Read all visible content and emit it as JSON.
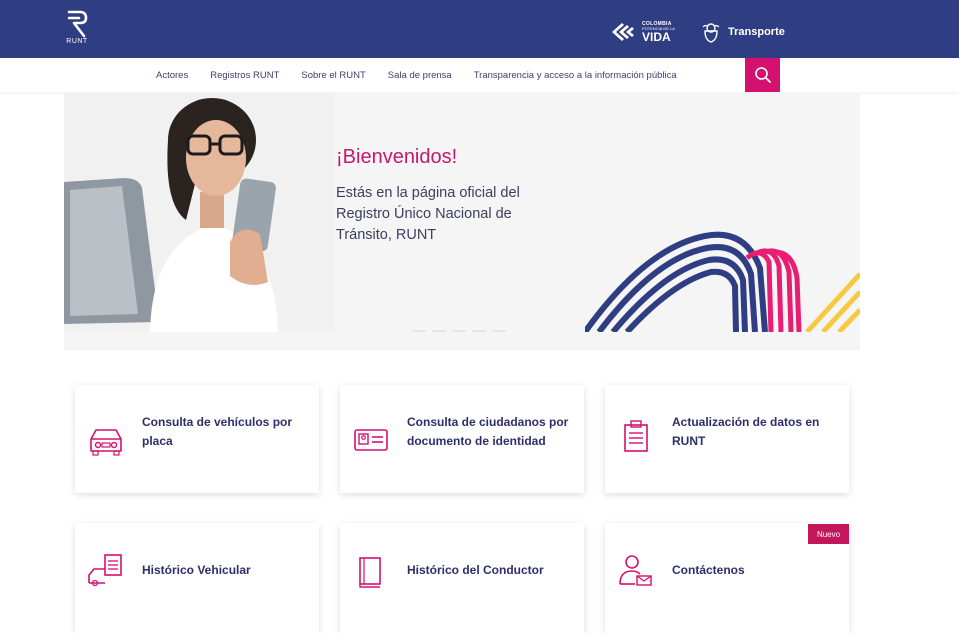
{
  "header": {
    "logo_text": "RUNT",
    "colombia_line1": "COLOMBIA",
    "colombia_line2": "POTENCIA DE LA",
    "colombia_line3": "VIDA",
    "ministry": "Transporte"
  },
  "nav": {
    "items": [
      {
        "label": "Actores"
      },
      {
        "label": "Registros RUNT"
      },
      {
        "label": "Sobre el RUNT"
      },
      {
        "label": "Sala de prensa"
      },
      {
        "label": "Transparencia y acceso a la información pública"
      }
    ],
    "search_icon": "search-icon"
  },
  "hero": {
    "title": "¡Bienvenidos!",
    "text": "Estás en la página oficial del Registro Único Nacional de Tránsito, RUNT",
    "prev_icon": "chevron-left-icon"
  },
  "cards": [
    {
      "label": "Consulta de vehículos por placa",
      "icon": "car-icon"
    },
    {
      "label": "Consulta de ciudadanos por documento de identidad",
      "icon": "id-card-icon"
    },
    {
      "label": "Actualización de datos en RUNT",
      "icon": "document-icon"
    },
    {
      "label": "Histórico Vehicular",
      "icon": "vehicle-history-icon"
    },
    {
      "label": "Histórico del Conductor",
      "icon": "book-icon"
    },
    {
      "label": "Contáctenos",
      "icon": "contact-icon",
      "badge": "Nuevo"
    }
  ],
  "colors": {
    "header_bg": "#2f3e83",
    "accent_pink": "#d4116f",
    "text_navy": "#2c2f6b"
  }
}
